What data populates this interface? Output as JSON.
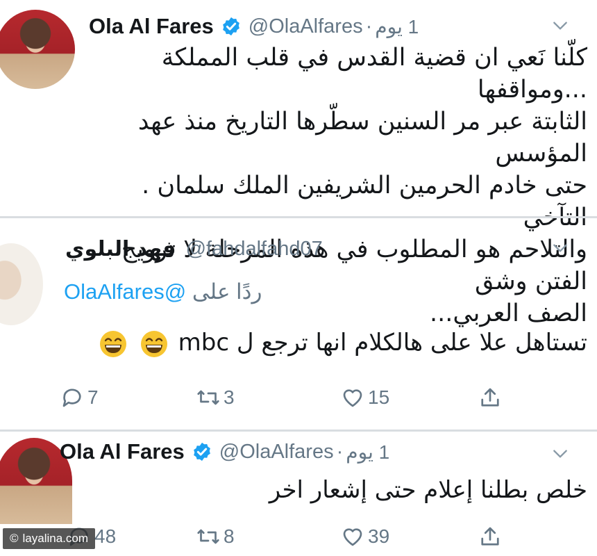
{
  "tweet1": {
    "name": "Ola Al Fares",
    "handle": "@OlaAlfares",
    "time": "1 يوم",
    "lines": [
      "كلّنا نَعي ان قضية القدس في قلب المملكة ...ومواقفها",
      "الثابتة عبر مر السنين سطّرها التاريخ منذ عهد المؤسس",
      "حتى خادم الحرمين الشريفين الملك سلمان .  التآخي",
      "والتلاحم  هو المطلوب في هذه المرحلة لا ترويج الفتن وشق",
      "الصف العربي..."
    ]
  },
  "tweet2": {
    "name": "فهد البلوي",
    "handle": "@fahdalfahd07",
    "reply_label": "ردًا على",
    "reply_handle": "@OlaAlfares",
    "text": "تستاهل علا على هالكلام انها ترجع ل mbc",
    "replies": "7",
    "retweets": "3",
    "likes": "15"
  },
  "tweet3": {
    "name": "Ola Al Fares",
    "handle": "@OlaAlfares",
    "time": "1 يوم",
    "text": "خلص بطلنا إعلام حتى إشعار اخر",
    "replies": "48",
    "retweets": "8",
    "likes": "39"
  },
  "watermark": "layalina.com",
  "icons": {
    "verified": "verified-badge-icon",
    "chevron": "chevron-down-icon",
    "reply": "reply-icon",
    "retweet": "retweet-icon",
    "like": "heart-icon",
    "share": "share-icon",
    "emoji": "grinning-emoji-icon"
  },
  "colors": {
    "accent": "#1da1f2",
    "secondary_text": "#657786",
    "emoji": "#f7c531"
  }
}
